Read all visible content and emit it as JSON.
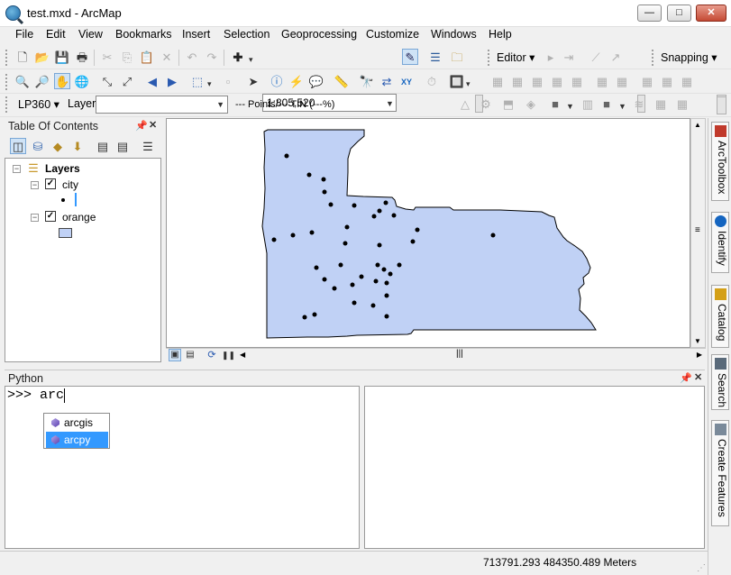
{
  "window": {
    "title": "test.mxd - ArcMap"
  },
  "menu": [
    "File",
    "Edit",
    "View",
    "Bookmarks",
    "Insert",
    "Selection",
    "Geoprocessing",
    "Customize",
    "Windows",
    "Help"
  ],
  "toolbar": {
    "scale": "1:805,520",
    "editor_label": "Editor",
    "snapping_label": "Snapping",
    "lp360_label": "LP360",
    "layer_label": "Layer:",
    "layer_value": "",
    "points_tin_label": "--- Points/--- TIN (---%)"
  },
  "toc": {
    "title": "Table Of Contents",
    "root": "Layers",
    "layers": [
      {
        "name": "city",
        "checked": true
      },
      {
        "name": "orange",
        "checked": true
      }
    ],
    "fill_color": "#c0d1f5"
  },
  "map": {
    "background": "#ffffff",
    "polygon_fill": "#c0d1f5",
    "polygon_stroke": "#000000"
  },
  "dock": {
    "tabs": [
      "ArcToolbox",
      "Identify",
      "Catalog",
      "Search",
      "Create Features"
    ]
  },
  "python": {
    "title": "Python",
    "prompt": ">>>",
    "input": "arc",
    "suggestions": [
      {
        "label": "arcgis",
        "selected": false
      },
      {
        "label": "arcpy",
        "selected": true
      }
    ]
  },
  "status": {
    "coordinates": "713791.293  484350.489 Meters"
  }
}
